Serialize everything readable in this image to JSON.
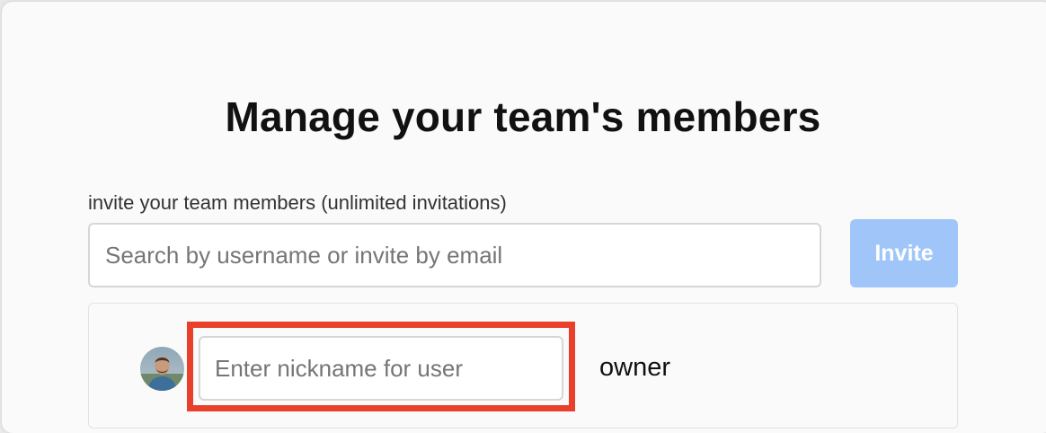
{
  "modal": {
    "title": "Manage your team's members"
  },
  "invite": {
    "label": "invite your team members (unlimited invitations)",
    "search_placeholder": "Search by username or invite by email",
    "search_value": "",
    "button_label": "Invite"
  },
  "members": [
    {
      "avatar_icon": "user-avatar",
      "nickname_placeholder": "Enter nickname for user",
      "nickname_value": "",
      "role": "owner"
    }
  ],
  "colors": {
    "invite_button_bg": "#a0c6f9",
    "highlight": "#e8402a"
  }
}
